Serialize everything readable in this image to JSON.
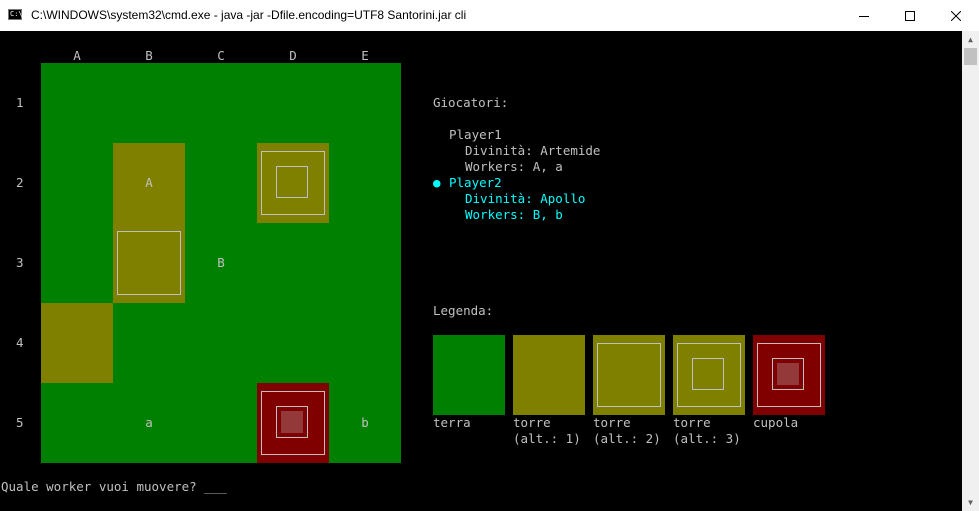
{
  "window": {
    "title": "C:\\WINDOWS\\system32\\cmd.exe - java  -jar -Dfile.encoding=UTF8 Santorini.jar cli",
    "icon_label": "C:\\",
    "minimize_icon": "minimize-icon",
    "maximize_icon": "maximize-icon",
    "close_icon": "close-icon"
  },
  "board": {
    "columns": [
      "A",
      "B",
      "C",
      "D",
      "E"
    ],
    "rows": [
      "1",
      "2",
      "3",
      "4",
      "5"
    ],
    "colors": {
      "ground": "#008000",
      "level": "#808000",
      "dome": "#800000",
      "outline": "#c0c0c0"
    },
    "cells": [
      {
        "col": 1,
        "row": 1,
        "level": 1,
        "worker": "A"
      },
      {
        "col": 3,
        "row": 1,
        "level": 3,
        "worker": ""
      },
      {
        "col": 1,
        "row": 2,
        "level": 2,
        "worker": ""
      },
      {
        "col": 2,
        "row": 2,
        "level": 0,
        "worker": "B"
      },
      {
        "col": 0,
        "row": 3,
        "level": 1,
        "worker": ""
      },
      {
        "col": 1,
        "row": 4,
        "level": 0,
        "worker": "a"
      },
      {
        "col": 3,
        "row": 4,
        "level": 4,
        "worker": ""
      },
      {
        "col": 4,
        "row": 4,
        "level": 0,
        "worker": "b"
      }
    ]
  },
  "players": {
    "heading": "Giocatori:",
    "list": [
      {
        "name": "Player1",
        "divinity": "Divinità: Artemide",
        "workers": "Workers: A, a",
        "active": false,
        "marker": ""
      },
      {
        "name": "Player2",
        "divinity": "Divinità: Apollo",
        "workers": "Workers: B, b",
        "active": true,
        "marker": "●",
        "color": "#00ffff"
      }
    ]
  },
  "legend": {
    "heading": "Legenda:",
    "items": [
      {
        "label": "terra",
        "sub": "",
        "level": 0
      },
      {
        "label": "torre",
        "sub": "(alt.: 1)",
        "level": 1
      },
      {
        "label": "torre",
        "sub": "(alt.: 2)",
        "level": 2
      },
      {
        "label": "torre",
        "sub": "(alt.: 3)",
        "level": 3
      },
      {
        "label": "cupola",
        "sub": "",
        "level": 4
      }
    ]
  },
  "prompt": {
    "text": "Quale worker vuoi muovere? ___"
  }
}
